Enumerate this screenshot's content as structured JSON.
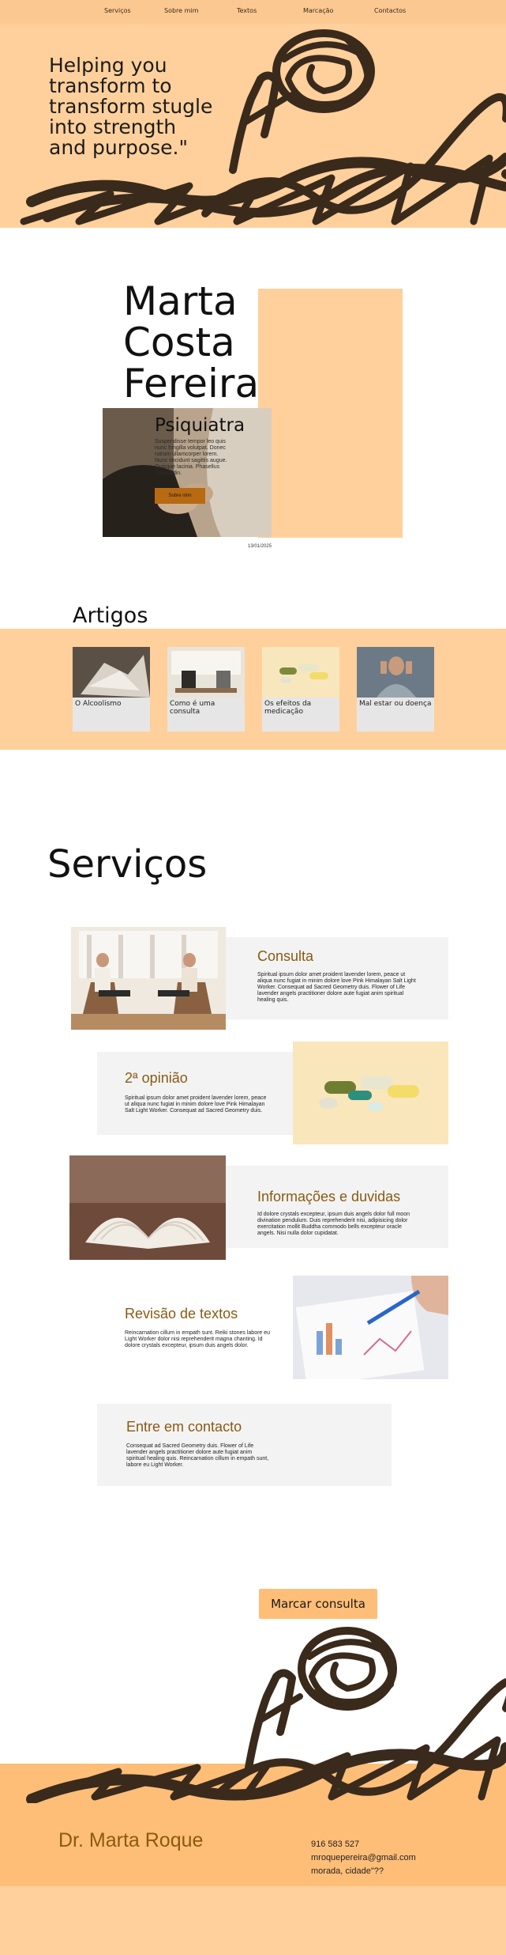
{
  "nav": {
    "items": [
      "Serviços",
      "Sobre mim",
      "Textos",
      "Marcação",
      "Contactos"
    ]
  },
  "hero": {
    "tagline": "Helping you transform to transform stugle into strength and purpose.\""
  },
  "profile": {
    "name": "Marta Costa Fereira",
    "role": "Psiquiatra",
    "description": "Suspendisse tempor leo quis nunc fringilla volutpat. Donec rutrum ullamcorper lorem. Nunc tincidunt sagittis augue. Quisque lacinia. Phasellus sollicitudin.",
    "about_button": "Sobre mim",
    "date": "13/01/2025"
  },
  "artigos": {
    "title": "Artigos",
    "cards": [
      {
        "title": "O Alcoolismo"
      },
      {
        "title": "Como é uma consulta"
      },
      {
        "title": "Os efeitos da medicação"
      },
      {
        "title": "Mal estar ou doença"
      }
    ]
  },
  "servicos": {
    "title": "Serviços",
    "items": [
      {
        "title": "Consulta",
        "desc": "Spiritual ipsum dolor amet proident lavender lorem, peace ut aliqua nunc fugiat in minim dolore love Pink Himalayan Salt Light Worker. Consequat ad Sacred Geometry duis. Flower of Life lavender angels practitioner dolore aute fugiat anim spiritual healing quis."
      },
      {
        "title": "2ª opinião",
        "desc": "Spiritual ipsum dolor amet proident lavender lorem, peace ut aliqua nunc fugiat in minim dolore love Pink Himalayan Salt Light Worker. Consequat ad Sacred Geometry duis."
      },
      {
        "title": "Informações e duvidas",
        "desc": "Id dolore crystals excepteur, ipsum duis angels dolor full moon divination pendulum. Duis reprehenderit nisi, adipisicing dolor exercitation mollit Buddha commodo bells excepteur oracle angels. Nisi nulla dolor cupidatat."
      },
      {
        "title": "Revisão de textos",
        "desc": "Reincarnation cillum in empath sunt. Reiki stones labore eu Light Worker dolor nisi reprehenderit magna chanting. Id dolore crystals excepteur, ipsum duis angels dolor."
      },
      {
        "title": "Entre em contacto",
        "desc": "Consequat ad Sacred Geometry duis. Flower of Life lavender angels practitioner dolore aute fugiat anim spiritual healing quis. Reincarnation cillum in empath sunt, labore eu Light Worker."
      }
    ]
  },
  "cta": {
    "label": "Marcar consulta"
  },
  "footer": {
    "name": "Dr. Marta Roque",
    "phone": "916 583 527",
    "email": "mroquepereira@gmail.com",
    "address": "morada, cidade\"??"
  },
  "colors": {
    "peach": "#ffd09b",
    "orange": "#ffbe78",
    "brown_accent": "#8a5a12",
    "scribble": "#3a2a1c",
    "grey_box": "#f3f3f3"
  }
}
